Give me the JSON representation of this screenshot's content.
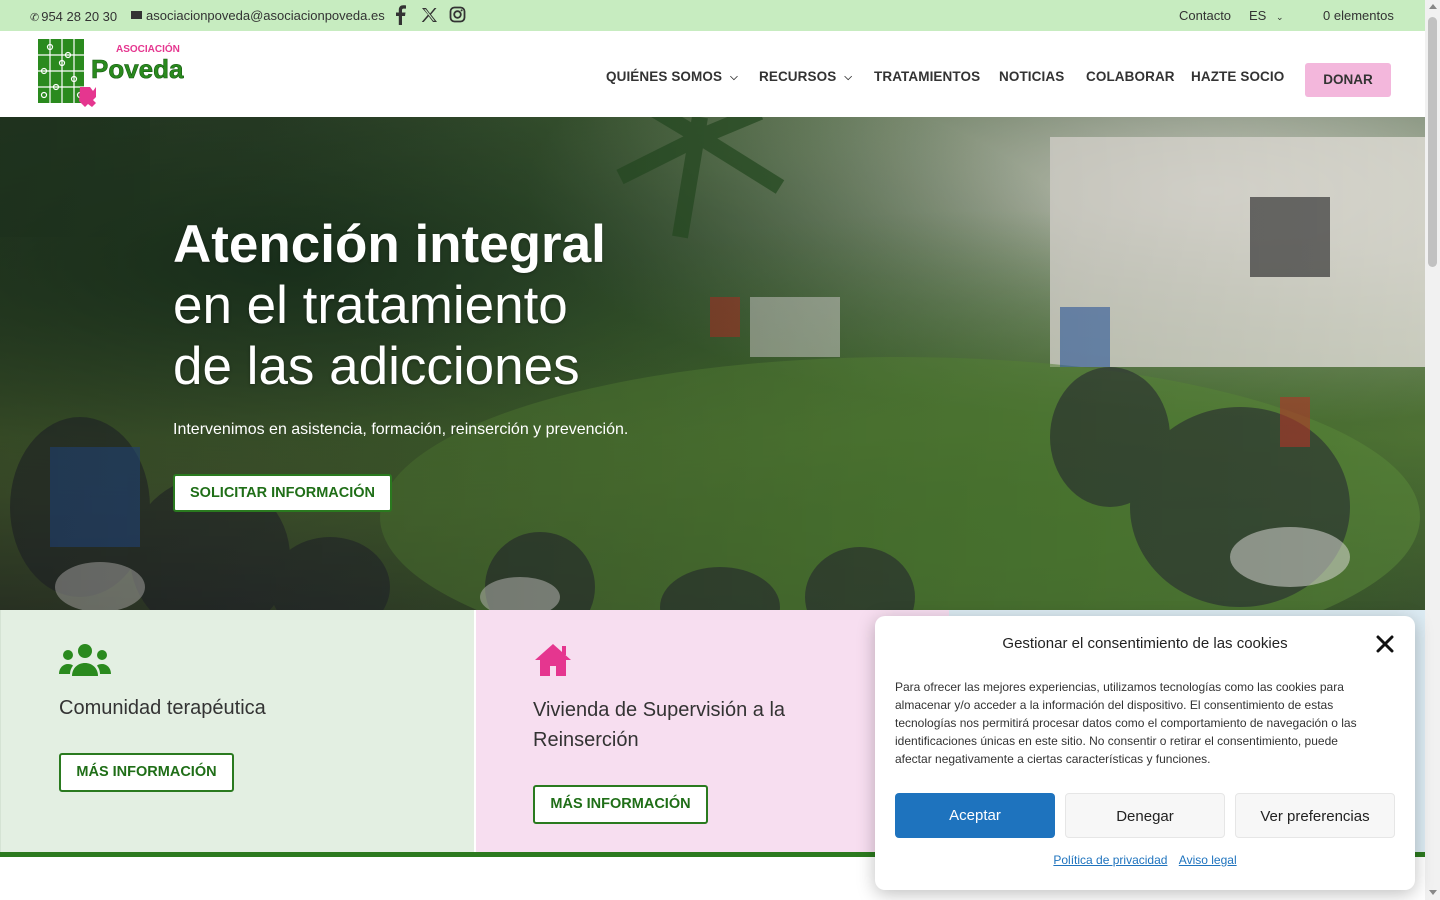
{
  "topbar": {
    "phone": "954 28 20 30",
    "email": "asociacionpoveda@asociacionpoveda.es",
    "social": [
      "facebook-icon",
      "x-icon",
      "instagram-icon"
    ],
    "contact": "Contacto",
    "lang": "ES",
    "cart": "0 elementos"
  },
  "logo": {
    "line1": "ASOCIACIÓN",
    "line2": "Poveda"
  },
  "nav": {
    "items": [
      {
        "label": "QUIÉNES SOMOS",
        "has_dropdown": true
      },
      {
        "label": "RECURSOS",
        "has_dropdown": true
      },
      {
        "label": "TRATAMIENTOS"
      },
      {
        "label": "NOTICIAS"
      },
      {
        "label": "COLABORAR"
      },
      {
        "label": "HAZTE SOCIO"
      }
    ],
    "donate": "DONAR"
  },
  "hero": {
    "title_bold": "Atención integral",
    "title_line2": "en el tratamiento",
    "title_line3": "de las adicciones",
    "subtitle": "Intervenimos en asistencia, formación, reinserción y prevención.",
    "cta": "SOLICITAR INFORMACIÓN"
  },
  "cards": [
    {
      "icon": "users-icon",
      "title": "Comunidad terapéutica",
      "button": "MÁS INFORMACIÓN"
    },
    {
      "icon": "home-icon",
      "title": "Vivienda de Supervisión a la Reinserción",
      "button": "MÁS INFORMACIÓN"
    }
  ],
  "cookie": {
    "title": "Gestionar el consentimiento de las cookies",
    "text": "Para ofrecer las mejores experiencias, utilizamos tecnologías como las cookies para almacenar y/o acceder a la información del dispositivo. El consentimiento de estas tecnologías nos permitirá procesar datos como el comportamiento de navegación o las identificaciones únicas en este sitio. No consentir o retirar el consentimiento, puede afectar negativamente a ciertas características y funciones.",
    "accept": "Aceptar",
    "deny": "Denegar",
    "preferences": "Ver preferencias",
    "privacy": "Política de privacidad",
    "legal": "Aviso legal"
  },
  "colors": {
    "topbar_bg": "#c7ecc0",
    "brand_green": "#2a7a1f",
    "brand_pink": "#e5368f",
    "donate_bg": "#f3b7dc",
    "accept_blue": "#1e73be"
  }
}
